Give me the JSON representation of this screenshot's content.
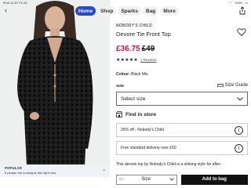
{
  "status": {
    "carrier": "iPad",
    "time": "14:57",
    "date": "Fri 28",
    "battery": "100%"
  },
  "nav": {
    "tabs": [
      {
        "label": "Home",
        "active": true
      },
      {
        "label": "Shop",
        "active": false
      },
      {
        "label": "Sparks",
        "active": false
      },
      {
        "label": "Bag",
        "active": false
      },
      {
        "label": "More",
        "active": false
      }
    ]
  },
  "popular": {
    "title": "POPULAR",
    "subtitle": "6 people are looking at this right now",
    "close": "×"
  },
  "product": {
    "brand": "NOBODY'S CHILD",
    "title": "Devore Tie Front Top",
    "price_now": "£36.75",
    "price_was": "£49",
    "rating": 5,
    "reviews": "1 Reviews",
    "colour_label": "Colour:",
    "colour_value": "Black Mix"
  },
  "size": {
    "label": "SIZE",
    "guide": "Size Guide",
    "select_placeholder": "Select size"
  },
  "store": {
    "label": "Find in store"
  },
  "promos": [
    {
      "text": "25% off - Nobody's Child"
    },
    {
      "text": "Free standard delivery over £60"
    }
  ],
  "description": "This devoré top by Nobody's Child is a striking style for after-",
  "bottom": {
    "size_label": "Size",
    "add_to_bag": "Add to bag"
  },
  "colors": {
    "accent": "#2d4bc0",
    "sale_price": "#d01345"
  }
}
